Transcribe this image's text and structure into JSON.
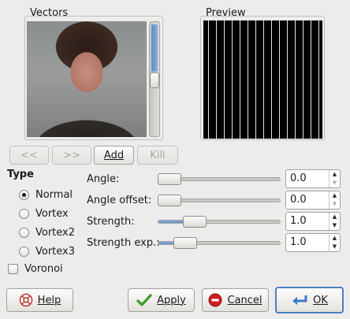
{
  "vectors": {
    "title": "Vectors"
  },
  "preview": {
    "title": "Preview"
  },
  "vector_buttons": {
    "prev_label": "<<",
    "next_label": ">>",
    "add_label": "Add",
    "kill_label": "Kill"
  },
  "type_section": {
    "title": "Type",
    "options": [
      {
        "label": "Normal",
        "selected": true
      },
      {
        "label": "Vortex",
        "selected": false
      },
      {
        "label": "Vortex2",
        "selected": false
      },
      {
        "label": "Vortex3",
        "selected": false
      }
    ],
    "voronoi_label": "Voronoi",
    "voronoi_checked": false
  },
  "params": [
    {
      "label": "Angle:",
      "value": "0.0",
      "level": 0.0
    },
    {
      "label": "Angle offset:",
      "value": "0.0",
      "level": 0.0
    },
    {
      "label": "Strength:",
      "value": "1.0",
      "level": 0.1
    },
    {
      "label": "Strength exp.:",
      "value": "1.0",
      "level": 0.05
    }
  ],
  "dialog_buttons": {
    "help_label": "Help",
    "apply_label": "Apply",
    "cancel_label": "Cancel",
    "ok_label": "OK"
  },
  "colors": {
    "accent": "#5f8ec7",
    "apply_check": "#3a9c2a",
    "cancel_red": "#cc1f1f",
    "ok_arrow": "#3b78c4"
  }
}
